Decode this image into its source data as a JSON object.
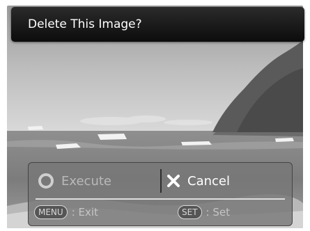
{
  "dialog_title": "Delete This Image?",
  "options": {
    "execute_label": "Execute",
    "cancel_label": "Cancel",
    "selected": "Cancel"
  },
  "hints": {
    "menu_key": "MENU",
    "menu_action": ": Exit",
    "set_key": "SET",
    "set_action": ": Set"
  },
  "colors": {
    "title_bar": "#111111",
    "panel": "#787878",
    "selected_text": "#ffffff",
    "unselected_text": "#b9b9b9"
  },
  "icons": {
    "execute": "ring-icon",
    "cancel": "x-icon"
  }
}
